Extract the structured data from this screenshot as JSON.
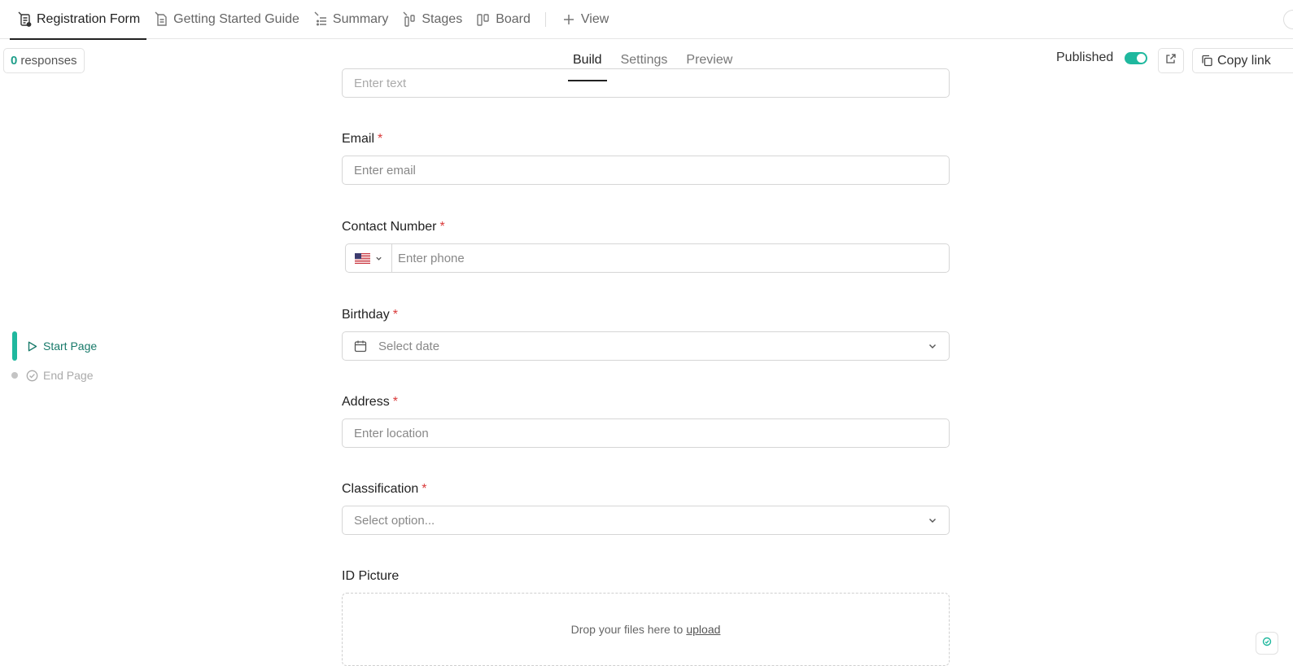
{
  "tabs": [
    {
      "label": "Registration Form",
      "icon": "form-pin-icon",
      "active": true
    },
    {
      "label": "Getting Started Guide",
      "icon": "document-pin-icon"
    },
    {
      "label": "Summary",
      "icon": "list-pin-icon"
    },
    {
      "label": "Stages",
      "icon": "stages-pin-icon"
    },
    {
      "label": "Board",
      "icon": "board-icon"
    }
  ],
  "add_view": {
    "label": "View"
  },
  "responses": {
    "count": "0",
    "label": "responses"
  },
  "modes": [
    {
      "label": "Build",
      "active": true
    },
    {
      "label": "Settings"
    },
    {
      "label": "Preview"
    }
  ],
  "published": {
    "label": "Published",
    "on": true
  },
  "copy_link": {
    "label": "Copy link"
  },
  "pages": [
    {
      "label": "Start Page",
      "active": true
    },
    {
      "label": "End Page",
      "active": false
    }
  ],
  "form": {
    "partial_field": {
      "placeholder": "Enter text"
    },
    "email": {
      "label": "Email",
      "placeholder": "Enter email",
      "required": "*"
    },
    "contact": {
      "label": "Contact Number",
      "placeholder": "Enter phone",
      "required": "*",
      "country": "US"
    },
    "birthday": {
      "label": "Birthday",
      "placeholder": "Select date",
      "required": "*"
    },
    "address": {
      "label": "Address",
      "placeholder": "Enter location",
      "required": "*"
    },
    "classification": {
      "label": "Classification",
      "placeholder": "Select option...",
      "required": "*"
    },
    "id_picture": {
      "label": "ID Picture",
      "drop_text": "Drop your files here to",
      "upload_link": "upload"
    }
  },
  "colors": {
    "accent": "#1fb89e",
    "required": "#d93a3a",
    "active_page": "#187a6a"
  }
}
